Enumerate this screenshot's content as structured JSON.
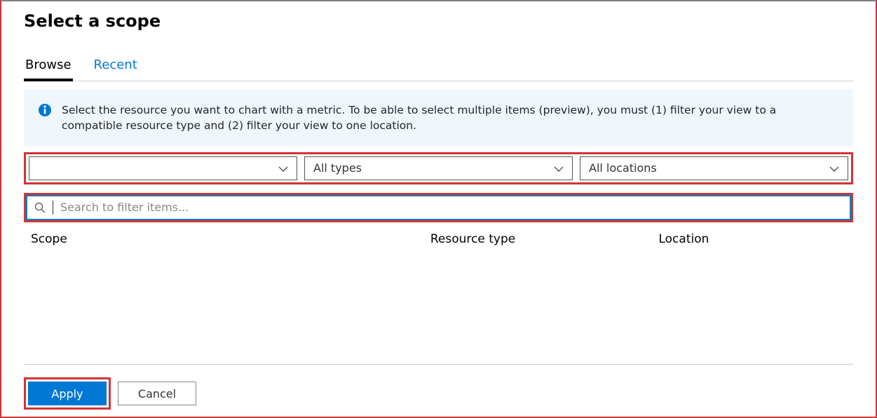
{
  "title": "Select a scope",
  "tabs": {
    "browse": "Browse",
    "recent": "Recent"
  },
  "info": {
    "text": "Select the resource you want to chart with a metric. To be able to select multiple items (preview), you must (1) filter your view to a compatible resource type and (2) filter your view to one location."
  },
  "filters": {
    "subscription": "",
    "resource_type": "All types",
    "location": "All locations"
  },
  "search": {
    "value": "",
    "placeholder": "Search to filter items..."
  },
  "table": {
    "headers": {
      "scope": "Scope",
      "resource_type": "Resource type",
      "location": "Location"
    }
  },
  "buttons": {
    "apply": "Apply",
    "cancel": "Cancel"
  },
  "colors": {
    "accent": "#0078d4",
    "highlight": "#d13438",
    "info_bg": "#eff6fc"
  }
}
